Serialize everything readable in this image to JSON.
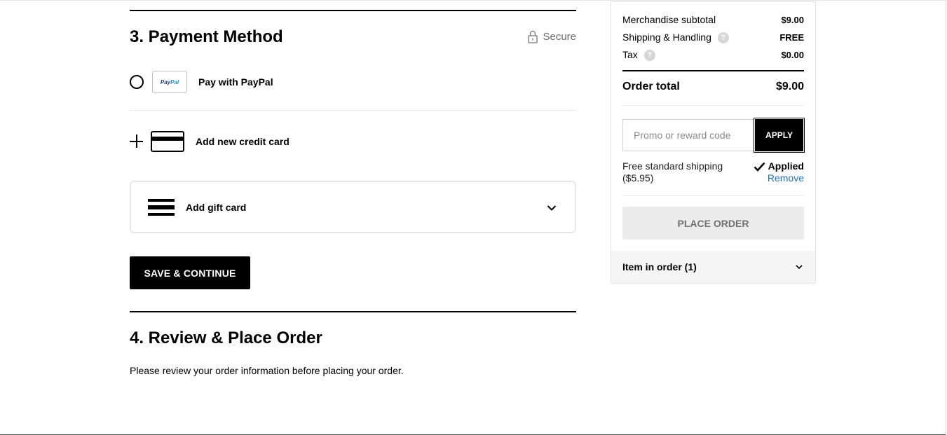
{
  "payment": {
    "section_title": "3. Payment Method",
    "secure_label": "Secure",
    "paypal": {
      "logo_text_1": "Pay",
      "logo_text_2": "Pal",
      "label": "Pay with PayPal"
    },
    "credit_card": {
      "label": "Add new credit card"
    },
    "gift_card": {
      "label": "Add gift card"
    },
    "save_button": "SAVE & CONTINUE"
  },
  "review": {
    "section_title": "4. Review & Place Order",
    "description": "Please review your order information before placing your order."
  },
  "summary": {
    "merch_label": "Merchandise subtotal",
    "merch_value": "$9.00",
    "shipping_label": "Shipping & Handling",
    "shipping_value": "FREE",
    "tax_label": "Tax",
    "tax_value": "$0.00",
    "total_label": "Order total",
    "total_value": "$9.00",
    "promo_placeholder": "Promo or reward code",
    "apply_label": "APPLY",
    "promo_name": "Free standard shipping",
    "promo_amount": "($5.95)",
    "applied_label": "Applied",
    "remove_label": "Remove",
    "place_order_label": "PLACE ORDER",
    "items_label": "Item in order (1)",
    "help_glyph": "?"
  },
  "icons": [
    "lock-icon",
    "paypal-logo",
    "plus-icon",
    "credit-card-icon",
    "gift-card-icon",
    "chevron-down-icon",
    "help-icon",
    "checkmark-icon"
  ],
  "colors": {
    "link": "#1a73c9",
    "primary_button": "#000000",
    "disabled_button": "#ececec"
  }
}
